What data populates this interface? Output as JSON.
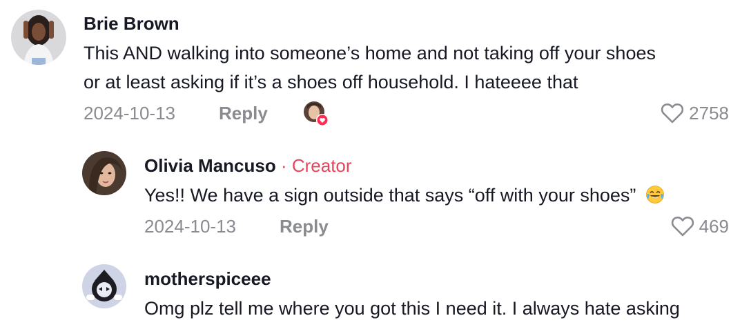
{
  "comments": [
    {
      "author": "Brie Brown",
      "text_line1": "This AND walking into someone’s home and not taking off your shoes",
      "text_line2": "or at least asking if it’s a shoes off household. I hateeee that",
      "date": "2024-10-13",
      "reply_label": "Reply",
      "likes": "2758"
    },
    {
      "author": "Olivia Mancuso",
      "creator_tag": " · Creator",
      "text_line1": "Yes!! We have a sign outside that says “off with your shoes”",
      "emoji": "joy-emoji",
      "date": "2024-10-13",
      "reply_label": "Reply",
      "likes": "469"
    },
    {
      "author": "motherspiceee",
      "text_line1": "Omg plz tell me where you got this I need it. I always hate asking"
    }
  ],
  "icons": {
    "like": "heart-outline-icon",
    "creator_liked": "heart-badge-icon"
  },
  "colors": {
    "text": "#161823",
    "muted": "#8a8b91",
    "creator": "#e8445a",
    "badge": "#fe2c55"
  }
}
